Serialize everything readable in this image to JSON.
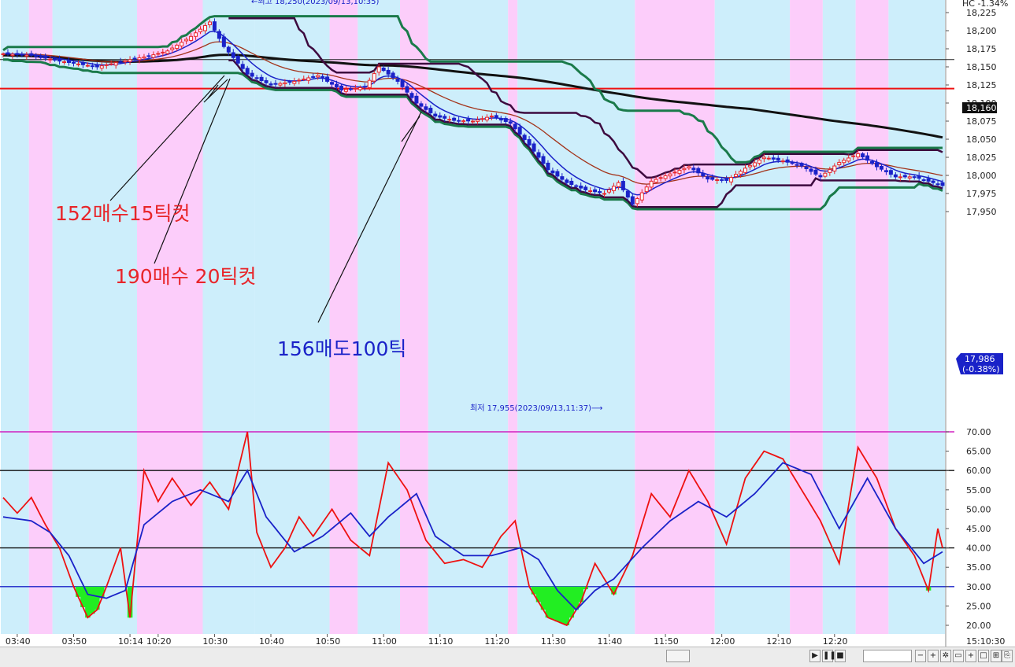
{
  "header": {
    "change_text": "HC  -1.34%"
  },
  "price_axis": {
    "ticks": [
      "18,225",
      "18,200",
      "18,175",
      "18,150",
      "18,125",
      "18,100",
      "18,075",
      "18,050",
      "18,025",
      "18,000",
      "17,975",
      "17,950"
    ]
  },
  "osc_axis": {
    "ticks": [
      "70.00",
      "65.00",
      "60.00",
      "55.00",
      "50.00",
      "45.00",
      "40.00",
      "35.00",
      "30.00",
      "25.00",
      "20.00"
    ]
  },
  "time_axis": {
    "labels": [
      "03:40",
      "03:50",
      "10:14",
      "10:20",
      "10:30",
      "10:40",
      "10:50",
      "11:00",
      "11:10",
      "11:20",
      "11:30",
      "11:40",
      "11:50",
      "12:00",
      "12:10",
      "12:20"
    ]
  },
  "current": {
    "price": "17,986",
    "change": "(-0.38%)",
    "hline_label": "18,160"
  },
  "status": {
    "clock": "15:10:30"
  },
  "annotations": {
    "high": "←최고 18,250(2023/09/13,10:35)",
    "low": "최저 17,955(2023/09/13,11:37)⟶",
    "note1": "152매수15틱컷",
    "note2": "190매수 20틱컷",
    "note3": "156매도100틱"
  },
  "toolbar": {
    "icons": [
      "play-icon",
      "pause-icon",
      "stop-icon",
      "zoom-out-icon",
      "zoom-in-icon",
      "settings-icon",
      "expand-icon",
      "plus-icon",
      "window-icon",
      "tile-icon",
      "export-icon"
    ]
  },
  "colors": {
    "bg_blue": "#cdeefb",
    "bg_pink": "#fccdfa",
    "up": "#e8252a",
    "down": "#1a22c8",
    "ma_blue": "#1a22c8",
    "ma_brown": "#a3331a",
    "ma_black": "#111111",
    "chan_green": "#1a7a4a",
    "chan_purple": "#3d0a3f",
    "red_line": "#ee1111",
    "osc_red": "#ee1111",
    "osc_blue": "#1a22c8",
    "osc_fill": "#22ee22"
  },
  "chart_data": [
    {
      "type": "candlestick",
      "timeframe": "1 minute",
      "ylim": [
        17950,
        18225
      ],
      "x_labels": [
        "03:40",
        "03:50",
        "10:14",
        "10:20",
        "10:30",
        "10:40",
        "10:50",
        "11:00",
        "11:10",
        "11:20",
        "11:30",
        "11:40",
        "11:50",
        "12:00",
        "12:10",
        "12:20"
      ],
      "anchors": [
        {
          "i": 0,
          "v": 18168
        },
        {
          "i": 6,
          "v": 18166
        },
        {
          "i": 12,
          "v": 18158
        },
        {
          "i": 20,
          "v": 18150
        },
        {
          "i": 27,
          "v": 18160
        },
        {
          "i": 31,
          "v": 18165
        },
        {
          "i": 35,
          "v": 18172
        },
        {
          "i": 40,
          "v": 18192
        },
        {
          "i": 44,
          "v": 18212
        },
        {
          "i": 47,
          "v": 18178
        },
        {
          "i": 52,
          "v": 18140
        },
        {
          "i": 57,
          "v": 18125
        },
        {
          "i": 62,
          "v": 18130
        },
        {
          "i": 67,
          "v": 18138
        },
        {
          "i": 72,
          "v": 18118
        },
        {
          "i": 77,
          "v": 18122
        },
        {
          "i": 80,
          "v": 18150
        },
        {
          "i": 84,
          "v": 18130
        },
        {
          "i": 88,
          "v": 18100
        },
        {
          "i": 92,
          "v": 18082
        },
        {
          "i": 96,
          "v": 18076
        },
        {
          "i": 100,
          "v": 18075
        },
        {
          "i": 104,
          "v": 18082
        },
        {
          "i": 108,
          "v": 18072
        },
        {
          "i": 112,
          "v": 18042
        },
        {
          "i": 116,
          "v": 18008
        },
        {
          "i": 120,
          "v": 17990
        },
        {
          "i": 124,
          "v": 17980
        },
        {
          "i": 128,
          "v": 17975
        },
        {
          "i": 131,
          "v": 17990
        },
        {
          "i": 134,
          "v": 17960
        },
        {
          "i": 138,
          "v": 17992
        },
        {
          "i": 142,
          "v": 18002
        },
        {
          "i": 146,
          "v": 18012
        },
        {
          "i": 150,
          "v": 17995
        },
        {
          "i": 154,
          "v": 17993
        },
        {
          "i": 158,
          "v": 18010
        },
        {
          "i": 162,
          "v": 18025
        },
        {
          "i": 166,
          "v": 18020
        },
        {
          "i": 170,
          "v": 18013
        },
        {
          "i": 174,
          "v": 17998
        },
        {
          "i": 178,
          "v": 18018
        },
        {
          "i": 182,
          "v": 18030
        },
        {
          "i": 186,
          "v": 18012
        },
        {
          "i": 190,
          "v": 17998
        },
        {
          "i": 194,
          "v": 17998
        },
        {
          "i": 198,
          "v": 17990
        },
        {
          "i": 200,
          "v": 17986
        }
      ],
      "moving_averages": [
        {
          "name": "MA short",
          "color": "#1a22c8"
        },
        {
          "name": "MA mid",
          "color": "#a3331a"
        },
        {
          "name": "MA long",
          "color": "#111111"
        }
      ],
      "horizontal_lines": [
        18160,
        18120
      ],
      "high": {
        "value": 18250,
        "time": "2023/09/13,10:35"
      },
      "low": {
        "value": 17955,
        "time": "2023/09/13,11:37"
      },
      "last": {
        "value": 17986,
        "change_pct": -0.38
      }
    },
    {
      "type": "line",
      "ylim": [
        19,
        71
      ],
      "reference_lines": [
        70,
        60,
        40,
        30
      ],
      "series": [
        {
          "name": "osc_fast",
          "color": "#ee1111",
          "anchors": [
            {
              "i": 0,
              "v": 53
            },
            {
              "i": 3,
              "v": 49
            },
            {
              "i": 6,
              "v": 53
            },
            {
              "i": 9,
              "v": 46
            },
            {
              "i": 12,
              "v": 40
            },
            {
              "i": 15,
              "v": 30
            },
            {
              "i": 18,
              "v": 22
            },
            {
              "i": 20,
              "v": 24
            },
            {
              "i": 22,
              "v": 30
            },
            {
              "i": 25,
              "v": 40
            },
            {
              "i": 27,
              "v": 22
            },
            {
              "i": 30,
              "v": 60
            },
            {
              "i": 33,
              "v": 52
            },
            {
              "i": 36,
              "v": 58
            },
            {
              "i": 40,
              "v": 51
            },
            {
              "i": 44,
              "v": 57
            },
            {
              "i": 48,
              "v": 50
            },
            {
              "i": 52,
              "v": 70
            },
            {
              "i": 54,
              "v": 44
            },
            {
              "i": 57,
              "v": 35
            },
            {
              "i": 60,
              "v": 40
            },
            {
              "i": 63,
              "v": 48
            },
            {
              "i": 66,
              "v": 43
            },
            {
              "i": 70,
              "v": 50
            },
            {
              "i": 74,
              "v": 42
            },
            {
              "i": 78,
              "v": 38
            },
            {
              "i": 82,
              "v": 62
            },
            {
              "i": 86,
              "v": 55
            },
            {
              "i": 90,
              "v": 42
            },
            {
              "i": 94,
              "v": 36
            },
            {
              "i": 98,
              "v": 37
            },
            {
              "i": 102,
              "v": 35
            },
            {
              "i": 106,
              "v": 43
            },
            {
              "i": 109,
              "v": 47
            },
            {
              "i": 112,
              "v": 30
            },
            {
              "i": 116,
              "v": 22
            },
            {
              "i": 120,
              "v": 20
            },
            {
              "i": 123,
              "v": 26
            },
            {
              "i": 126,
              "v": 36
            },
            {
              "i": 130,
              "v": 28
            },
            {
              "i": 134,
              "v": 38
            },
            {
              "i": 138,
              "v": 54
            },
            {
              "i": 142,
              "v": 48
            },
            {
              "i": 146,
              "v": 60
            },
            {
              "i": 150,
              "v": 52
            },
            {
              "i": 154,
              "v": 41
            },
            {
              "i": 158,
              "v": 58
            },
            {
              "i": 162,
              "v": 65
            },
            {
              "i": 166,
              "v": 63
            },
            {
              "i": 170,
              "v": 55
            },
            {
              "i": 174,
              "v": 47
            },
            {
              "i": 178,
              "v": 36
            },
            {
              "i": 182,
              "v": 66
            },
            {
              "i": 186,
              "v": 58
            },
            {
              "i": 190,
              "v": 45
            },
            {
              "i": 194,
              "v": 38
            },
            {
              "i": 197,
              "v": 29
            },
            {
              "i": 199,
              "v": 45
            },
            {
              "i": 200,
              "v": 40
            }
          ]
        },
        {
          "name": "osc_slow",
          "color": "#1a22c8",
          "anchors": [
            {
              "i": 0,
              "v": 48
            },
            {
              "i": 6,
              "v": 47
            },
            {
              "i": 10,
              "v": 44
            },
            {
              "i": 14,
              "v": 38
            },
            {
              "i": 18,
              "v": 28
            },
            {
              "i": 22,
              "v": 27
            },
            {
              "i": 26,
              "v": 29
            },
            {
              "i": 30,
              "v": 46
            },
            {
              "i": 36,
              "v": 52
            },
            {
              "i": 42,
              "v": 55
            },
            {
              "i": 48,
              "v": 52
            },
            {
              "i": 52,
              "v": 60
            },
            {
              "i": 56,
              "v": 48
            },
            {
              "i": 62,
              "v": 39
            },
            {
              "i": 68,
              "v": 43
            },
            {
              "i": 74,
              "v": 49
            },
            {
              "i": 78,
              "v": 43
            },
            {
              "i": 82,
              "v": 48
            },
            {
              "i": 88,
              "v": 54
            },
            {
              "i": 92,
              "v": 43
            },
            {
              "i": 98,
              "v": 38
            },
            {
              "i": 104,
              "v": 38
            },
            {
              "i": 110,
              "v": 40
            },
            {
              "i": 114,
              "v": 37
            },
            {
              "i": 118,
              "v": 29
            },
            {
              "i": 122,
              "v": 24
            },
            {
              "i": 126,
              "v": 29
            },
            {
              "i": 130,
              "v": 32
            },
            {
              "i": 136,
              "v": 40
            },
            {
              "i": 142,
              "v": 47
            },
            {
              "i": 148,
              "v": 52
            },
            {
              "i": 154,
              "v": 48
            },
            {
              "i": 160,
              "v": 54
            },
            {
              "i": 166,
              "v": 62
            },
            {
              "i": 172,
              "v": 59
            },
            {
              "i": 178,
              "v": 45
            },
            {
              "i": 184,
              "v": 58
            },
            {
              "i": 190,
              "v": 45
            },
            {
              "i": 196,
              "v": 36
            },
            {
              "i": 200,
              "v": 39
            }
          ]
        }
      ]
    }
  ]
}
